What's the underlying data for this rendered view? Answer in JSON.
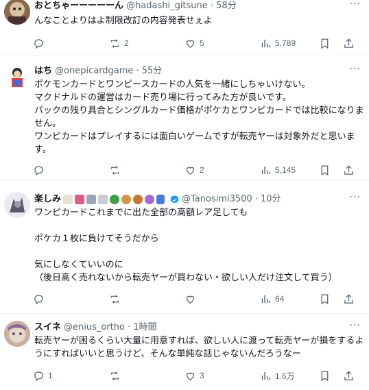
{
  "tweets": [
    {
      "name": "おとちゃーーーーーん",
      "handle": "@hadashi_gitsune",
      "time": "· 58分",
      "text": "んなことよりはよ制限改訂の内容発表せぇよ",
      "replies": "",
      "reposts": "2",
      "likes": "5",
      "views": "5,789",
      "avatar_icon": "avatar-image"
    },
    {
      "name": "はち",
      "handle": "@onepicardgame",
      "time": "· 55分",
      "text": "ポケモンカードとワンピースカードの人気を一緒にしちゃいけない。\nマクドナルドの運営はカード売り場に行ってみた方が良いです。\nパックの残り具合とシングルカード価格がポケカとワンピカードでは比較になりません。\nワンピカードはプレイするには面白いゲームですが転売ヤーは対象外だと思います。",
      "replies": "",
      "reposts": "",
      "likes": "2",
      "views": "5,145",
      "avatar_icon": "avatar-image"
    },
    {
      "name": "楽しみ",
      "handle": "@Tanosimi3500",
      "time": "· 10分",
      "text": "ワンピカードこれまでに出た全部の高額レア足しても\n\nポケカ１枚に負けてそうだから\n\n気にしなくていいのに\n（後日高く売れないから転売ヤーが買わない・欲しい人だけ注文して買う）",
      "replies": "",
      "reposts": "",
      "likes": "",
      "views": "64",
      "avatar_icon": "avatar-image"
    },
    {
      "name": "スイネ",
      "handle": "@enius_ortho",
      "time": "· 1時間",
      "text": "転売ヤーが困るくらい大量に用意すれば、欲しい人に渡って転売ヤーが損をするようにすればいいと思うけど、そんな単純な話じゃないんだろうなー",
      "replies": "1",
      "reposts": "",
      "likes": "3",
      "views": "1.6万",
      "avatar_icon": "avatar-image"
    }
  ],
  "colors": {
    "text": "#0f1419",
    "secondary": "#536471",
    "divider": "#eff3f4",
    "verified": "#1d9bf0"
  }
}
